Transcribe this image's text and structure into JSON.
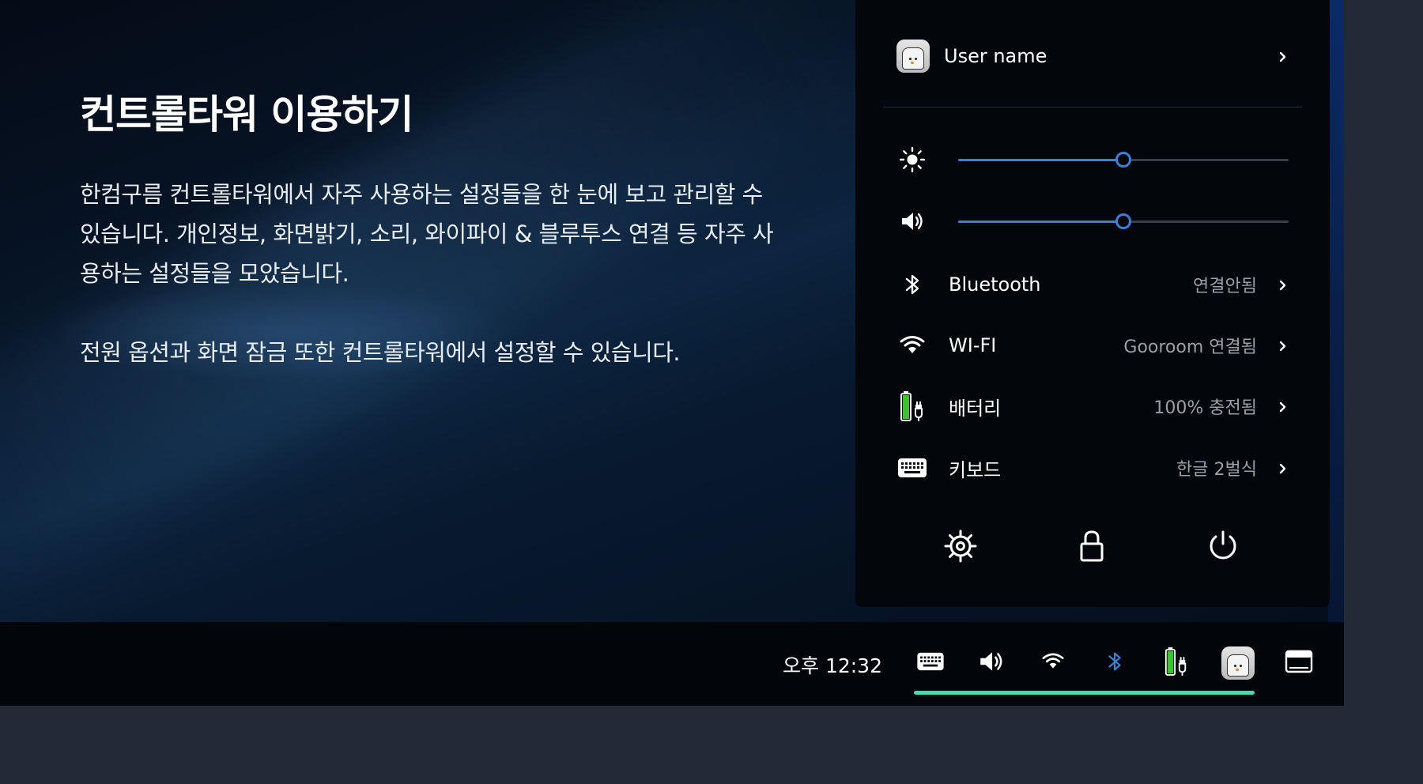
{
  "info": {
    "title": "컨트롤타워 이용하기",
    "paragraph1": "한컴구름 컨트롤타워에서 자주 사용하는 설정들을 한 눈에 보고 관리할 수 있습니다. 개인정보, 화면밝기, 소리, 와이파이 & 블루투스 연결 등 자주 사용하는 설정들을 모았습니다.",
    "paragraph2": "전원 옵션과 화면 잠금 또한 컨트롤타워에서 설정할 수 있습니다."
  },
  "panel": {
    "user": {
      "name": "User name"
    },
    "sliders": {
      "brightness": {
        "icon": "sun-icon",
        "level_percent": 50
      },
      "volume": {
        "icon": "speaker-icon",
        "level_percent": 50
      }
    },
    "settings": [
      {
        "id": "bluetooth",
        "icon": "bluetooth-icon",
        "label": "Bluetooth",
        "value": "연결안됨"
      },
      {
        "id": "wifi",
        "icon": "wifi-icon",
        "label": "WI-FI",
        "value": "Gooroom 연결됨"
      },
      {
        "id": "battery",
        "icon": "battery-icon",
        "label": "배터리",
        "value": "100% 충전됨"
      },
      {
        "id": "keyboard",
        "icon": "keyboard-icon",
        "label": "키보드",
        "value": "한글 2벌식"
      }
    ],
    "actions": [
      "settings-gear-icon",
      "lock-icon",
      "power-icon"
    ]
  },
  "taskbar": {
    "clock": "오후 12:32",
    "tray": [
      "keyboard-icon",
      "speaker-icon",
      "wifi-icon",
      "bluetooth-icon",
      "battery-icon",
      "avatar",
      "window-icon"
    ]
  },
  "colors": {
    "accent": "#3d7fd6",
    "active_indicator": "#4dd6b0",
    "battery_green": "#3fc22e",
    "bluetooth_tray": "#3d7fd6"
  }
}
